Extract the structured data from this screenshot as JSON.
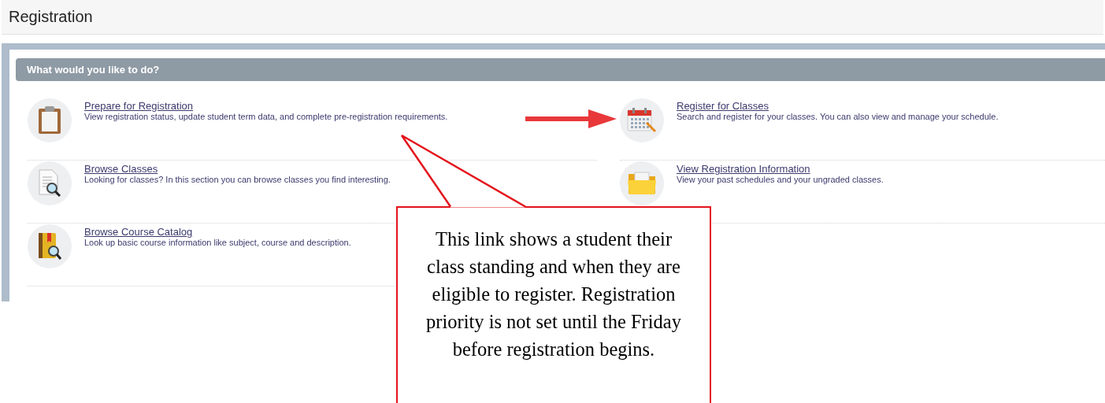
{
  "page_title": "Registration",
  "section": {
    "title": "What would you like to do?"
  },
  "left_actions": [
    {
      "title": "Prepare for Registration",
      "description": "View registration status, update student term data, and complete pre-registration requirements."
    },
    {
      "title": "Browse Classes",
      "description": "Looking for classes? In this section you can browse classes you find interesting."
    },
    {
      "title": "Browse Course Catalog",
      "description": "Look up basic course information like subject, course and description."
    }
  ],
  "right_actions": [
    {
      "title": "Register for Classes",
      "description": "Search and register for your classes. You can also view and manage your schedule."
    },
    {
      "title": "View Registration Information",
      "description": "View your past schedules and your ungraded classes."
    }
  ],
  "callout": {
    "text": "This link shows a student their class standing and when they are eligible to register. Registration priority is not set until the Friday before registration begins."
  }
}
